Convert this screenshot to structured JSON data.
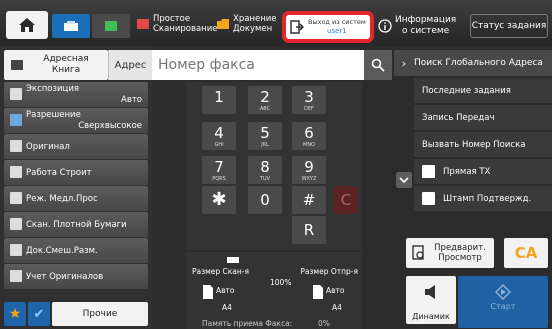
{
  "topbar": {
    "apps": [
      {
        "label": "Простое\nСканирование",
        "icon": "simple-scan-icon"
      },
      {
        "label": "Хранение\nДокумен",
        "icon": "document-filing-icon"
      }
    ],
    "logout": {
      "label": "Выход из систем",
      "user": "user1"
    },
    "sysinfo": {
      "label": "Информация\nо системе"
    },
    "job_status": "Статус задания",
    "accent_color": "#1b6fb8",
    "highlight_color": "#e3262f"
  },
  "left": {
    "address_book": "Адресная\nКнига",
    "address_label": "Адрес",
    "menu": [
      {
        "name": "Экспозиция",
        "value": "Авто",
        "icon": "exposure-icon"
      },
      {
        "name": "Разрешение",
        "value": "Сверхвысокое",
        "icon": "resolution-icon"
      },
      {
        "name": "Оригинал",
        "value": "",
        "icon": "original-icon"
      },
      {
        "name": "Работа Строит",
        "value": "",
        "icon": "job-build-icon"
      },
      {
        "name": "Реж. Медл.Прос",
        "value": "",
        "icon": "slow-scan-icon"
      },
      {
        "name": "Скан. Плотной Бумаги",
        "value": "",
        "icon": "thick-paper-icon"
      },
      {
        "name": "Док.Смеш.Разм.",
        "value": "",
        "icon": "mixed-size-icon"
      },
      {
        "name": "Учет Оригиналов",
        "value": "",
        "icon": "original-count-icon"
      }
    ],
    "more_label": "Прочие"
  },
  "fax": {
    "placeholder": "Номер факса"
  },
  "keypad": {
    "keys": [
      {
        "d": "1",
        "s": ""
      },
      {
        "d": "2",
        "s": "ABC"
      },
      {
        "d": "3",
        "s": "DEF"
      },
      {
        "d": "4",
        "s": "GHI"
      },
      {
        "d": "5",
        "s": "JKL"
      },
      {
        "d": "6",
        "s": "MNO"
      },
      {
        "d": "7",
        "s": "PQRS"
      },
      {
        "d": "8",
        "s": "TUV"
      },
      {
        "d": "9",
        "s": "WXYZ"
      },
      {
        "d": "✱",
        "s": ""
      },
      {
        "d": "0",
        "s": ""
      },
      {
        "d": "#",
        "s": ""
      },
      {
        "d": "C",
        "s": ""
      }
    ],
    "r_label": "R"
  },
  "size": {
    "scan_label": "Размер Скан-я",
    "scan_value": "Авто",
    "scan_paper": "A4",
    "ratio": "100%",
    "send_label": "Размер Отпр-я",
    "send_value": "Авто",
    "send_paper": "A4",
    "memory_label": "Память приема Факса:",
    "memory_value": "0%"
  },
  "right": {
    "global_search": "Поиск Глобального Адреса",
    "items": [
      "Последние задания",
      "Запись Передач",
      "Вызвать Номер Поиска"
    ],
    "checks": [
      "Прямая TX",
      "Штамп Подтвержд."
    ],
    "preview": "Предварит.\nПросмотр",
    "ca": "CA",
    "dynamic": "Динамик",
    "start": "Старт"
  }
}
